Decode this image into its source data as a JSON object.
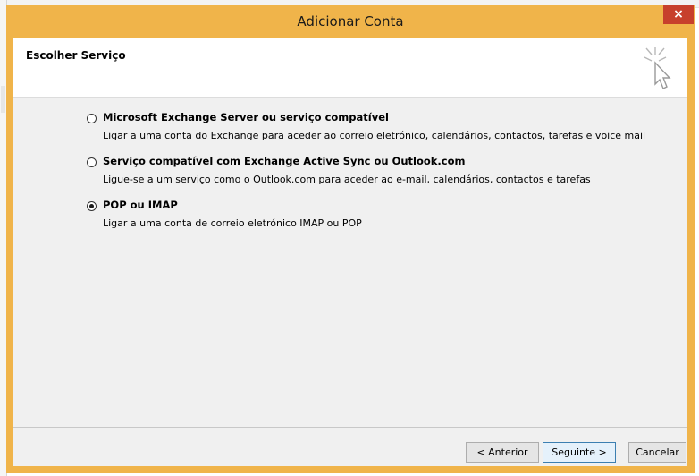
{
  "dialog": {
    "title": "Adicionar Conta",
    "close_label": "×",
    "header_title": "Escolher Serviço",
    "header_icon": "cursor-sparkle-icon"
  },
  "options": [
    {
      "title": "Microsoft Exchange Server ou serviço compatível",
      "description": "Ligar a uma conta do Exchange para aceder ao correio eletrónico, calendários, contactos, tarefas e voice mail",
      "selected": false
    },
    {
      "title": "Serviço compatível com Exchange Active Sync ou Outlook.com",
      "description": "Ligue-se a um serviço como o Outlook.com para aceder ao e-mail, calendários, contactos e tarefas",
      "selected": false
    },
    {
      "title": "POP ou IMAP",
      "description": "Ligar a uma conta de correio eletrónico IMAP ou POP",
      "selected": true
    }
  ],
  "buttons": {
    "back": "< Anterior",
    "next": "Seguinte >",
    "cancel": "Cancelar"
  },
  "colors": {
    "titlebar": "#f0b44a",
    "close": "#c7402c",
    "client_bg": "#f0f0f0"
  }
}
